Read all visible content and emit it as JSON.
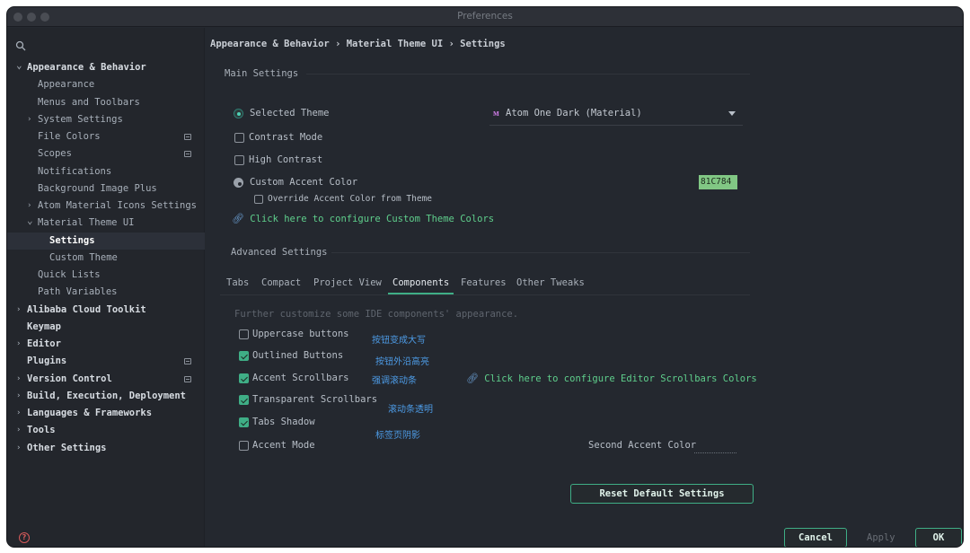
{
  "window": {
    "title": "Preferences"
  },
  "sidebar": {
    "items": [
      {
        "label": "Appearance & Behavior",
        "level": 0,
        "bold": true,
        "expanded": true
      },
      {
        "label": "Appearance",
        "level": 1
      },
      {
        "label": "Menus and Toolbars",
        "level": 1
      },
      {
        "label": "System Settings",
        "level": 1,
        "collapsed": true
      },
      {
        "label": "File Colors",
        "level": 1,
        "project": true
      },
      {
        "label": "Scopes",
        "level": 1,
        "project": true
      },
      {
        "label": "Notifications",
        "level": 1
      },
      {
        "label": "Background Image Plus",
        "level": 1
      },
      {
        "label": "Atom Material Icons Settings",
        "level": 1,
        "collapsed": true
      },
      {
        "label": "Material Theme UI",
        "level": 1,
        "expanded": true
      },
      {
        "label": "Settings",
        "level": 2,
        "selected": true
      },
      {
        "label": "Custom Theme",
        "level": 2
      },
      {
        "label": "Quick Lists",
        "level": 1
      },
      {
        "label": "Path Variables",
        "level": 1
      },
      {
        "label": "Alibaba Cloud Toolkit",
        "level": 0,
        "bold": true,
        "collapsed": true
      },
      {
        "label": "Keymap",
        "level": 0,
        "bold": true
      },
      {
        "label": "Editor",
        "level": 0,
        "bold": true,
        "collapsed": true
      },
      {
        "label": "Plugins",
        "level": 0,
        "bold": true,
        "project": true
      },
      {
        "label": "Version Control",
        "level": 0,
        "bold": true,
        "collapsed": true,
        "project": true
      },
      {
        "label": "Build, Execution, Deployment",
        "level": 0,
        "bold": true,
        "collapsed": true
      },
      {
        "label": "Languages & Frameworks",
        "level": 0,
        "bold": true,
        "collapsed": true
      },
      {
        "label": "Tools",
        "level": 0,
        "bold": true,
        "collapsed": true
      },
      {
        "label": "Other Settings",
        "level": 0,
        "bold": true,
        "collapsed": true
      }
    ]
  },
  "breadcrumb": "Appearance & Behavior › Material Theme UI › Settings",
  "main_settings": {
    "title": "Main Settings",
    "selected_theme_label": "Selected Theme",
    "selected_theme_value": "Atom One Dark (Material)",
    "contrast_mode_label": "Contrast Mode",
    "high_contrast_label": "High Contrast",
    "custom_accent_label": "Custom Accent Color",
    "accent_color_value": "81C784",
    "accent_color_hex": "#81c784",
    "override_accent_label": "Override Accent Color from Theme",
    "configure_link": "Click here to configure Custom Theme Colors"
  },
  "advanced_settings": {
    "title": "Advanced Settings",
    "tabs": [
      "Tabs",
      "Compact",
      "Project View",
      "Components",
      "Features",
      "Other Tweaks"
    ],
    "active_tab": "Components",
    "hint": "Further customize some IDE components' appearance.",
    "options": [
      {
        "label": "Uppercase buttons",
        "checked": false,
        "note": "按钮变成大写"
      },
      {
        "label": "Outlined Buttons",
        "checked": true,
        "note": "按钮外沿高亮"
      },
      {
        "label": "Accent Scrollbars",
        "checked": true,
        "note": "强调滚动条"
      },
      {
        "label": "Transparent Scrollbars",
        "checked": true,
        "note": "滚动条透明"
      },
      {
        "label": "Tabs Shadow",
        "checked": true,
        "note": "标签页阴影"
      },
      {
        "label": "Accent Mode",
        "checked": false,
        "note": ""
      }
    ],
    "scrollbar_link": "Click here to configure Editor Scrollbars Colors",
    "second_accent_label": "Second Accent Color"
  },
  "buttons": {
    "reset": "Reset Default Settings",
    "cancel": "Cancel",
    "apply": "Apply",
    "ok": "OK"
  },
  "colors": {
    "accent": "#3fae86",
    "link": "#5fcf8c",
    "annotation": "#4d9be6",
    "background": "#24282f"
  }
}
